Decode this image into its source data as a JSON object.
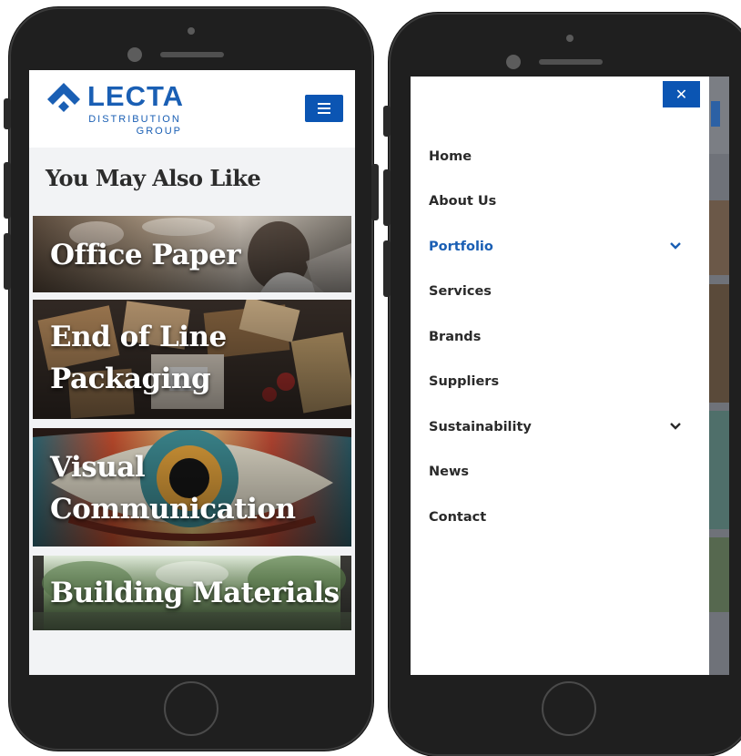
{
  "left_screen": {
    "brand": {
      "name": "LECTA",
      "subtitle_line1": "DISTRIBUTION",
      "subtitle_line2": "GROUP"
    },
    "menu_icon": "hamburger-icon",
    "section_title": "You May Also Like",
    "cards": [
      {
        "label": "Office Paper"
      },
      {
        "label": "End of Line\nPackaging"
      },
      {
        "label": "Visual\nCommunication"
      },
      {
        "label": "Building Materials"
      }
    ]
  },
  "right_screen": {
    "close_icon": "close-icon",
    "close_glyph": "✕",
    "nav_items": [
      {
        "label": "Home",
        "active": false
      },
      {
        "label": "About Us",
        "active": false
      },
      {
        "label": "Portfolio",
        "active": true,
        "has_submenu": true
      },
      {
        "label": "Services",
        "active": false
      },
      {
        "label": "Brands",
        "active": false
      },
      {
        "label": "Suppliers",
        "active": false
      },
      {
        "label": "Sustainability",
        "active": false,
        "has_submenu": true
      },
      {
        "label": "News",
        "active": false
      },
      {
        "label": "Contact",
        "active": false
      }
    ]
  },
  "colors": {
    "brand_blue": "#1a5fb4",
    "button_blue": "#0b55b3",
    "active_link": "#1a5fb4",
    "text_dark": "#2a2a2a",
    "phone_body": "#1f1f1f"
  }
}
